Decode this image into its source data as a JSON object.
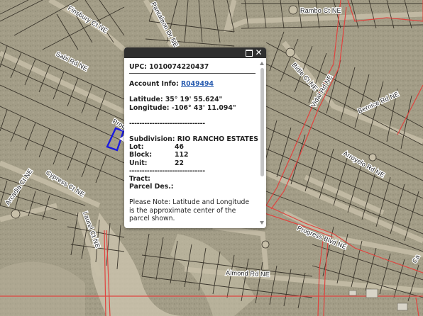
{
  "map": {
    "streets": [
      {
        "id": "finsbury",
        "label": "Finsbury Ct NE"
      },
      {
        "id": "pantaleon",
        "label": "Pantaleon Dr NE"
      },
      {
        "id": "rambo",
        "label": "Rambo Ct NE"
      },
      {
        "id": "sabi",
        "label": "Sabi Rd NE"
      },
      {
        "id": "bidle",
        "label": "Bidle Ct NE"
      },
      {
        "id": "vidal",
        "label": "Vidal Rd NE"
      },
      {
        "id": "bernice",
        "label": "Bernice Rd NE"
      },
      {
        "id": "progress-top",
        "label": "Prog"
      },
      {
        "id": "arcadia",
        "label": "Arcadia Ct NE"
      },
      {
        "id": "cypress",
        "label": "Cypress Ct NE"
      },
      {
        "id": "laurel",
        "label": "Laurel Ct NE"
      },
      {
        "id": "arroyelo",
        "label": "Arroyelo Rd NE"
      },
      {
        "id": "progress-blvd",
        "label": "Progress Blvd NE"
      },
      {
        "id": "almond",
        "label": "Almond Rd NE"
      },
      {
        "id": "ca-edge",
        "label": "Ca"
      }
    ],
    "colors": {
      "parcel_lines": "#3a352b",
      "boundary": "#e0443f",
      "highlight": "#1a1ae0"
    }
  },
  "popup": {
    "upc_label": "UPC:",
    "upc_value": "1010074220437",
    "account_label": "Account Info:",
    "account_value": "R049494",
    "latitude_label": "Latitude:",
    "latitude_value": "35° 19' 55.624\"",
    "longitude_label": "Longitude:",
    "longitude_value": "-106° 43' 11.094\"",
    "divider": "------------------------------",
    "subdivision_label": "Subdivision:",
    "subdivision_value": "RIO RANCHO ESTATES",
    "lot_label": "Lot:",
    "lot_value": "46",
    "block_label": "Block:",
    "block_value": "112",
    "unit_label": "Unit:",
    "unit_value": "22",
    "divider2": "------------------------------",
    "tract_label": "Tract:",
    "parcel_label": "Parcel Des.:",
    "note": "Please Note: Latitude and Longitude is the approximate center of the parcel shown."
  }
}
